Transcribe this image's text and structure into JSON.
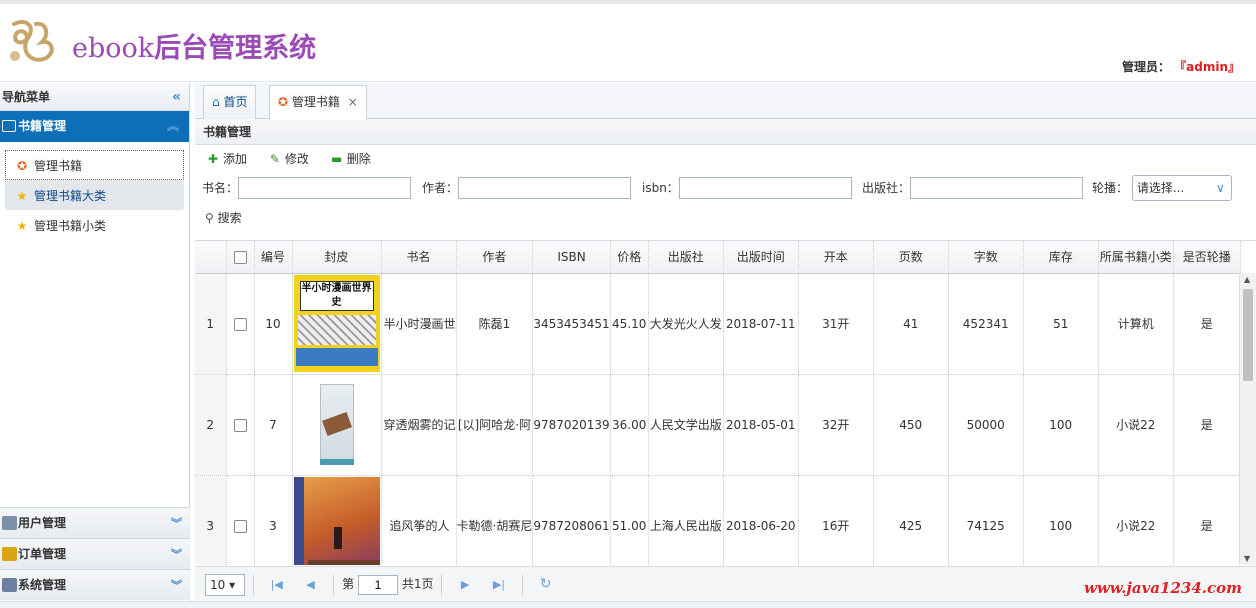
{
  "header": {
    "brand_en": "ebook",
    "brand_cn": "后台管理系统",
    "admin_label": "管理员：",
    "admin_name": "『admin』"
  },
  "sidebar": {
    "title": "导航菜单",
    "collapse_glyph": "«",
    "active_panel": "书籍管理",
    "items": [
      {
        "label": "管理书籍",
        "icon": "medal-icon"
      },
      {
        "label": "管理书籍大类",
        "icon": "star-icon"
      },
      {
        "label": "管理书籍小类",
        "icon": "star-icon"
      }
    ],
    "panels": [
      {
        "label": "用户管理",
        "icon": "users-icon"
      },
      {
        "label": "订单管理",
        "icon": "order-icon"
      },
      {
        "label": "系统管理",
        "icon": "system-icon"
      }
    ]
  },
  "tabs": [
    {
      "label": "首页",
      "icon": "home-icon"
    },
    {
      "label": "管理书籍",
      "icon": "medal-icon",
      "close": "×"
    }
  ],
  "panel_title": "书籍管理",
  "toolbar": {
    "add": "添加",
    "edit": "修改",
    "delete": "删除"
  },
  "search": {
    "name_label": "书名：",
    "author_label": "作者：",
    "isbn_label": "isbn：",
    "publisher_label": "出版社：",
    "carousel_label": "轮播：",
    "carousel_value": "请选择...",
    "button": "搜索"
  },
  "table": {
    "columns": [
      "",
      "编号",
      "封皮",
      "书名",
      "作者",
      "ISBN",
      "价格",
      "出版社",
      "出版时间",
      "开本",
      "页数",
      "字数",
      "库存",
      "所属书籍小类",
      "是否轮播"
    ],
    "rows": [
      {
        "rownum": "1",
        "id": "10",
        "name": "半小时漫画世",
        "author": "陈磊1",
        "isbn": "3453453451",
        "price": "45.10",
        "publisher": "大发光火人发",
        "date": "2018-07-11",
        "format": "31开",
        "pages": "41",
        "words": "452341",
        "stock": "51",
        "category": "计算机",
        "carousel": "是",
        "cover_title": "半小时漫画世界史"
      },
      {
        "rownum": "2",
        "id": "7",
        "name": "穿透烟雾的记",
        "author": "[以]阿哈龙·阿",
        "isbn": "9787020139",
        "price": "36.00",
        "publisher": "人民文学出版",
        "date": "2018-05-01",
        "format": "32开",
        "pages": "450",
        "words": "50000",
        "stock": "100",
        "category": "小说22",
        "carousel": "是",
        "cover_title": ""
      },
      {
        "rownum": "3",
        "id": "3",
        "name": "追风筝的人",
        "author": "卡勒德·胡赛尼",
        "isbn": "9787208061",
        "price": "51.00",
        "publisher": "上海人民出版",
        "date": "2018-06-20",
        "format": "16开",
        "pages": "425",
        "words": "74125",
        "stock": "100",
        "category": "小说22",
        "carousel": "是",
        "cover_title": ""
      }
    ]
  },
  "pager": {
    "page_size": "10",
    "page_prefix": "第",
    "page_value": "1",
    "page_total": "共1页",
    "watermark": "www.java1234.com"
  },
  "colors": {
    "accent": "#0d6fb8",
    "brand": "#9b4bb5",
    "admin_name": "#e02020"
  }
}
